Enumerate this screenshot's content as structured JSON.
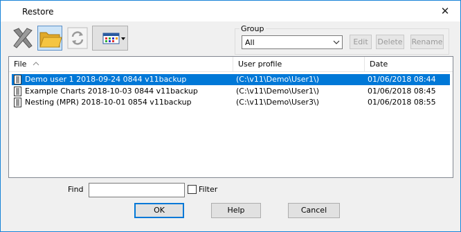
{
  "window": {
    "title": "Restore",
    "close_icon": "close-icon"
  },
  "toolbar": {
    "icons": [
      "delete-x-icon",
      "open-folder-icon",
      "refresh-icon",
      "view-options-icon"
    ]
  },
  "group": {
    "label": "Group",
    "selected": "All",
    "buttons": {
      "edit": "Edit",
      "delete": "Delete",
      "rename": "Rename"
    }
  },
  "list": {
    "columns": {
      "file": "File",
      "user_profile": "User profile",
      "date": "Date"
    },
    "rows": [
      {
        "file": "Demo user 1 2018-09-24 0844 v11backup",
        "user_profile": "(C:\\v11\\Demo\\User1\\)",
        "date": "01/06/2018  08:44",
        "selected": true
      },
      {
        "file": "Example Charts 2018-10-03 0844 v11backup",
        "user_profile": "(C:\\v11\\Demo\\User1\\)",
        "date": "01/06/2018  08:45",
        "selected": false
      },
      {
        "file": "Nesting (MPR) 2018-10-01 0854 v11backup",
        "user_profile": "(C:\\v11\\Demo\\User3\\)",
        "date": "01/06/2018  08:55",
        "selected": false
      }
    ]
  },
  "find": {
    "label": "Find",
    "value": "",
    "filter_label": "Filter",
    "filter_checked": false
  },
  "buttons": {
    "ok": "OK",
    "help": "Help",
    "cancel": "Cancel"
  },
  "colors": {
    "selection": "#0078d7",
    "window_border": "#1883d7",
    "folder": "#f5c542"
  }
}
